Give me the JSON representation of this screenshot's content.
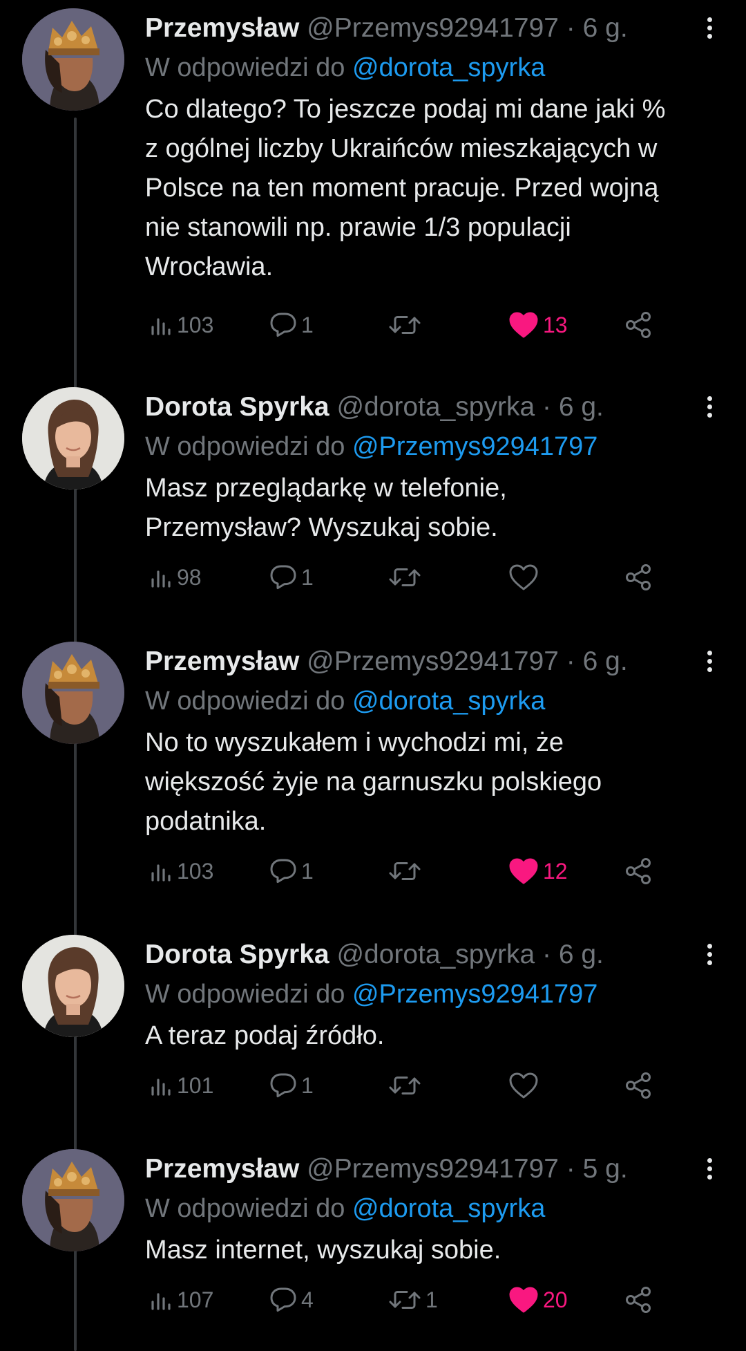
{
  "tweets": [
    {
      "name": "Przemysław",
      "handle": "@Przemys92941797",
      "time": "6 g.",
      "reply_prefix": "W odpowiedzi do",
      "reply_to": "@dorota_spyrka",
      "text": "Co dlatego? To jeszcze podaj mi dane jaki %\nz ogólnej liczby Ukraińców mieszkających w\nPolsce na ten moment pracuje. Przed wojną\nnie stanowili np. prawie 1/3 populacji\nWrocławia.",
      "views": "103",
      "replies": "1",
      "retweets": "",
      "likes": "13",
      "liked": true,
      "avatar": "king"
    },
    {
      "name": "Dorota Spyrka",
      "handle": "@dorota_spyrka",
      "time": "6 g.",
      "reply_prefix": "W odpowiedzi do",
      "reply_to": "@Przemys92941797",
      "text": "Masz przeglądarkę w telefonie,\nPrzemysław? Wyszukaj sobie.",
      "views": "98",
      "replies": "1",
      "retweets": "",
      "likes": "",
      "liked": false,
      "avatar": "woman"
    },
    {
      "name": "Przemysław",
      "handle": "@Przemys92941797",
      "time": "6 g.",
      "reply_prefix": "W odpowiedzi do",
      "reply_to": "@dorota_spyrka",
      "text": "No to wyszukałem i wychodzi mi, że\nwiększość żyje na garnuszku polskiego\npodatnika.",
      "views": "103",
      "replies": "1",
      "retweets": "",
      "likes": "12",
      "liked": true,
      "avatar": "king"
    },
    {
      "name": "Dorota Spyrka",
      "handle": "@dorota_spyrka",
      "time": "6 g.",
      "reply_prefix": "W odpowiedzi do",
      "reply_to": "@Przemys92941797",
      "text": "A teraz podaj źródło.",
      "views": "101",
      "replies": "1",
      "retweets": "",
      "likes": "",
      "liked": false,
      "avatar": "woman"
    },
    {
      "name": "Przemysław",
      "handle": "@Przemys92941797",
      "time": "5 g.",
      "reply_prefix": "W odpowiedzi do",
      "reply_to": "@dorota_spyrka",
      "text": "Masz internet, wyszukaj sobie.",
      "views": "107",
      "replies": "4",
      "retweets": "1",
      "likes": "20",
      "liked": true,
      "avatar": "king"
    }
  ],
  "colors": {
    "background": "#000000",
    "text": "#e7e9ea",
    "muted": "#71767b",
    "mention": "#1d9bf0",
    "like": "#f91880"
  },
  "icons": [
    "views-icon",
    "reply-icon",
    "retweet-icon",
    "heart-icon",
    "share-icon",
    "more-icon"
  ]
}
